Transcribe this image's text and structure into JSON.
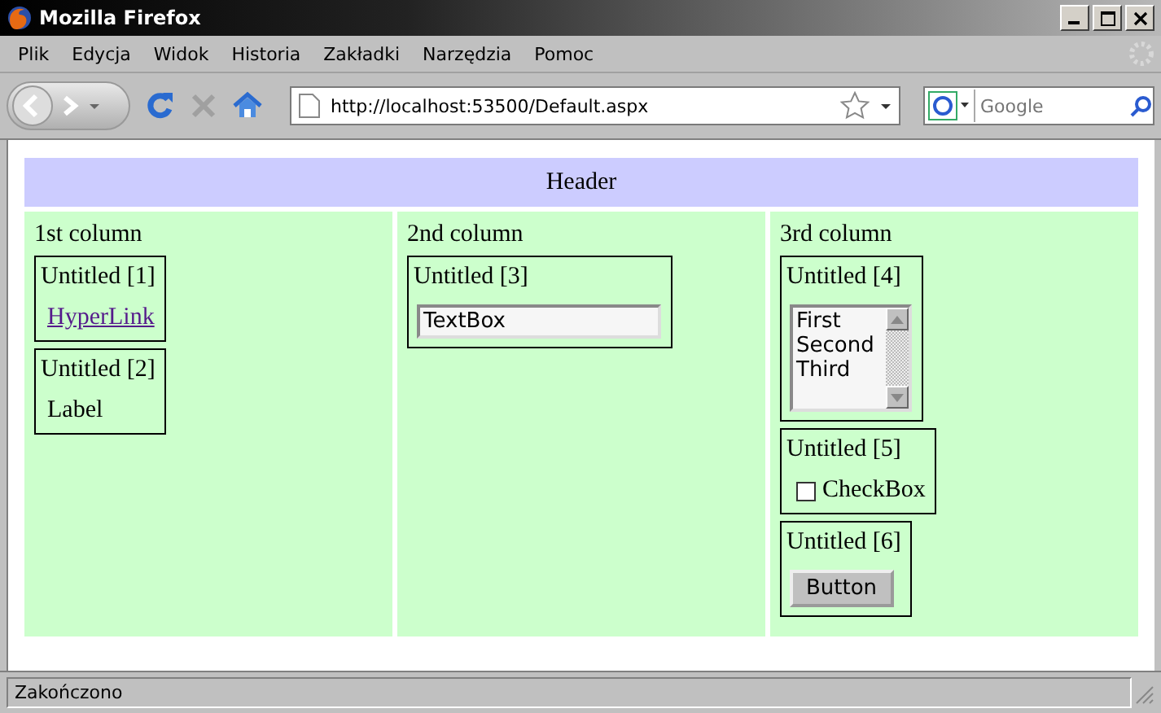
{
  "window": {
    "title": "Mozilla Firefox"
  },
  "menu": [
    "Plik",
    "Edycja",
    "Widok",
    "Historia",
    "Zakładki",
    "Narzędzia",
    "Pomoc"
  ],
  "address_bar": {
    "value": "http://localhost:53500/Default.aspx"
  },
  "search": {
    "placeholder": "Google"
  },
  "page": {
    "header": "Header",
    "columns": [
      {
        "title": "1st column",
        "panels": [
          {
            "title": "Untitled [1]",
            "kind": "link",
            "text": "HyperLink"
          },
          {
            "title": "Untitled [2]",
            "kind": "label",
            "text": "Label"
          }
        ]
      },
      {
        "title": "2nd column",
        "panels": [
          {
            "title": "Untitled [3]",
            "kind": "textbox",
            "value": "TextBox"
          }
        ]
      },
      {
        "title": "3rd column",
        "panels": [
          {
            "title": "Untitled [4]",
            "kind": "listbox",
            "items": [
              "First",
              "Second",
              "Third"
            ]
          },
          {
            "title": "Untitled [5]",
            "kind": "checkbox",
            "text": "CheckBox",
            "checked": false
          },
          {
            "title": "Untitled [6]",
            "kind": "button",
            "text": "Button"
          }
        ]
      }
    ]
  },
  "status_bar": {
    "text": "Zakończono"
  }
}
